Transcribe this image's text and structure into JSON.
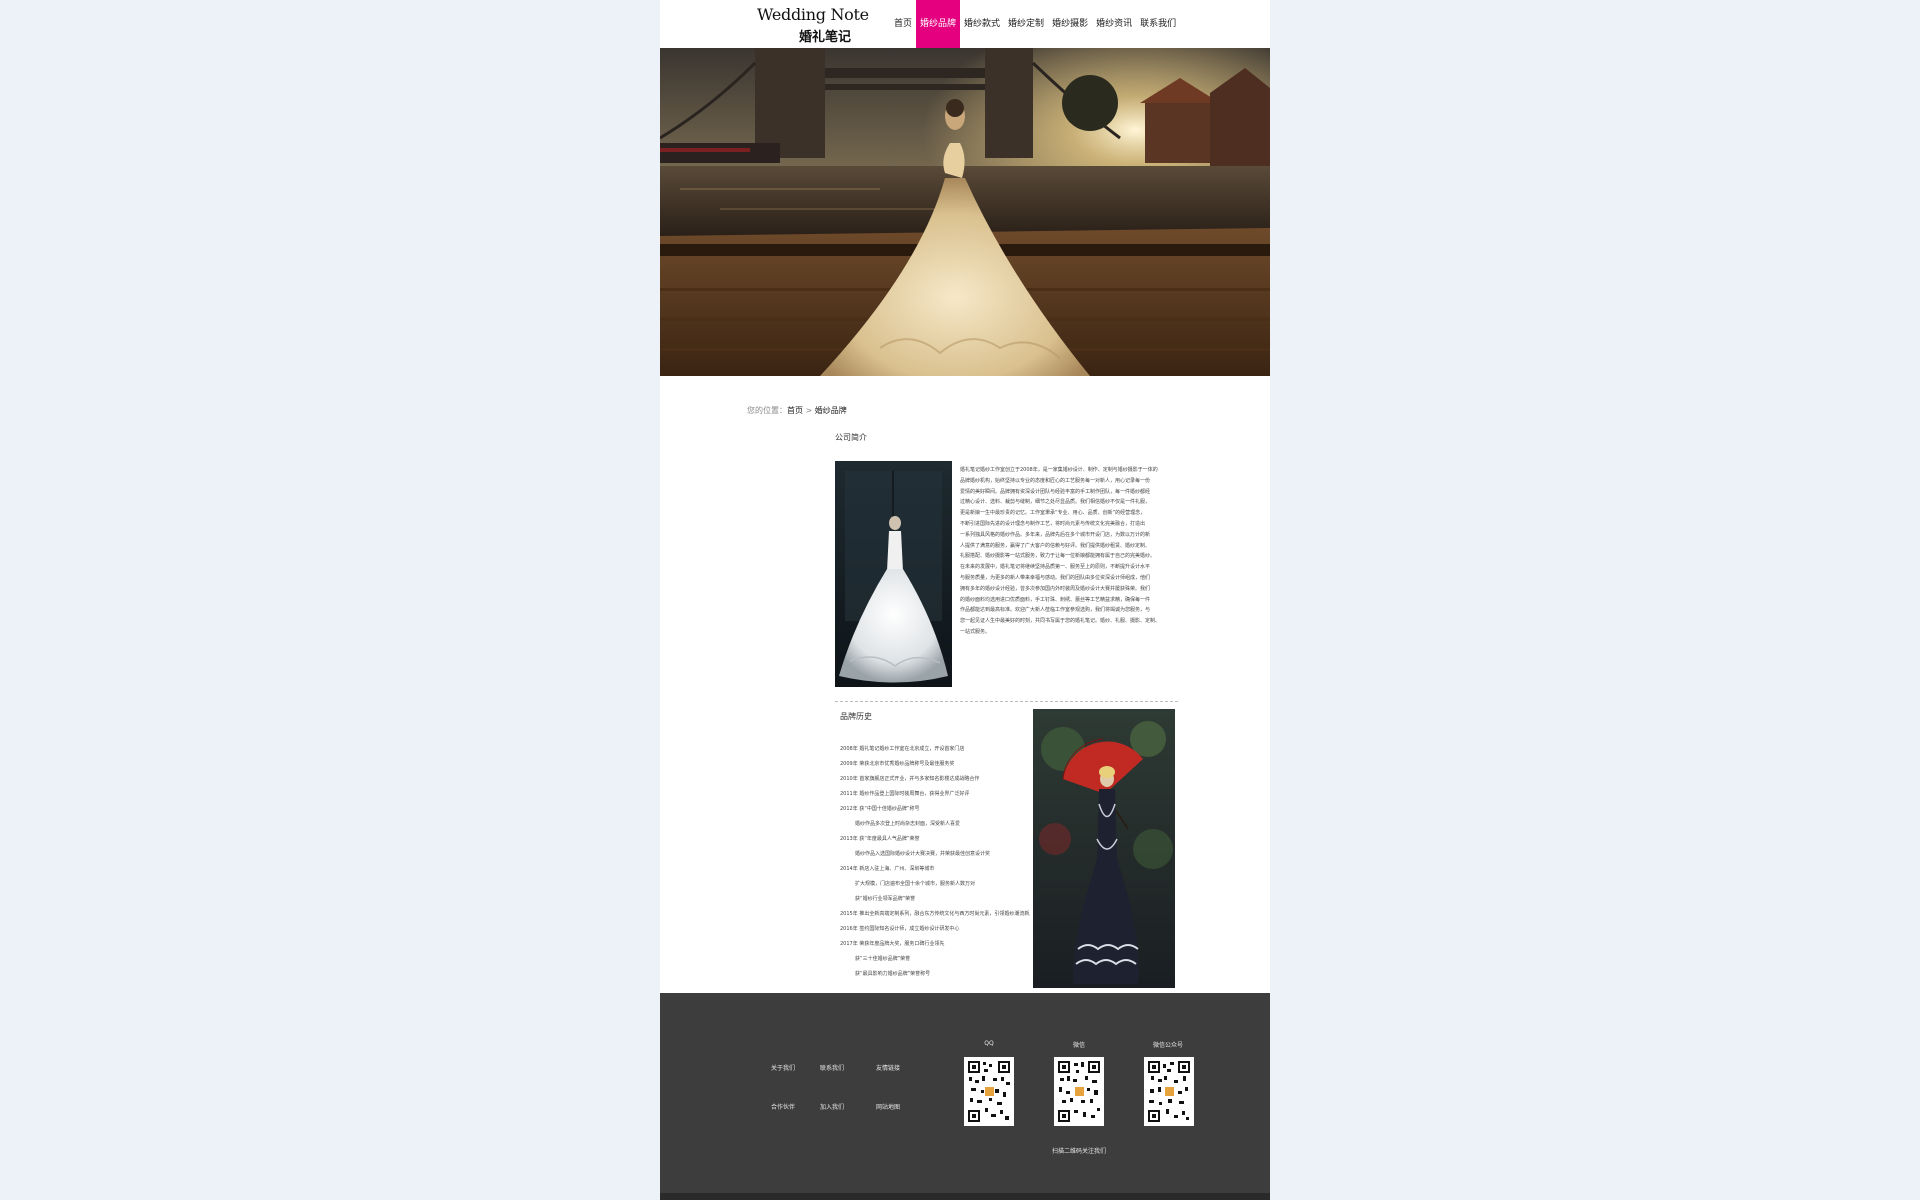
{
  "header": {
    "logo_en": "Wedding Note",
    "logo_cn": "婚礼笔记",
    "nav": [
      "首页",
      "婚纱品牌",
      "婚纱款式",
      "婚纱定制",
      "婚纱摄影",
      "婚纱资讯",
      "联系我们"
    ],
    "active_index": 1,
    "accent_color": "#e4007f"
  },
  "breadcrumb": {
    "prefix": "您的位置：",
    "home": "首页",
    "separator": " > ",
    "current": "婚纱品牌"
  },
  "intro": {
    "title": "公司简介",
    "lines": [
      "婚礼笔记婚纱工作室创立于2008年，是一家集婚纱设计、制作、定制与婚纱摄影于一体的",
      "品牌婚纱机构，始终坚持以专业的态度和匠心的工艺服务每一对新人，用心记录每一份",
      "爱情的美好瞬间。品牌拥有资深设计团队与经验丰富的手工制作团队，每一件婚纱都经",
      "过精心设计、选料、裁剪与缝制，细节之处尽显品质。我们相信婚纱不仅是一件礼服，",
      "更是新娘一生中最珍贵的记忆。工作室秉承“专业、用心、品质、创新”的经营理念，",
      "不断引进国际先进的设计理念与制作工艺，将时尚元素与传统文化完美融合，打造出",
      "一系列独具风格的婚纱作品。多年来，品牌先后在多个城市开设门店，为数以万计的新",
      "人提供了满意的服务，赢得了广大客户的信赖与好评。我们提供婚纱租赁、婚纱定制、",
      "礼服搭配、婚纱摄影等一站式服务，致力于让每一位新娘都能拥有属于自己的完美婚纱。",
      "在未来的发展中，婚礼笔记将继续坚持品质第一、服务至上的原则，不断提升设计水平",
      "与服务质量，为更多的新人带来幸福与感动。我们的团队由多位资深设计师组成，他们",
      "拥有多年的婚纱设计经验，曾多次参加国内外时装周及婚纱设计大赛并屡获殊荣。我们",
      "的婚纱面料均选用进口优质面料，手工钉珠、刺绣、蕾丝等工艺精益求精，确保每一件",
      "作品都能达到最高标准。欢迎广大新人莅临工作室参观选购，我们将竭诚为您服务，与",
      "您一起见证人生中最美好的时刻，共同书写属于您的婚礼笔记。婚纱、礼服、摄影、定制、",
      "一站式服务。"
    ]
  },
  "history": {
    "title": "品牌历史",
    "items": [
      {
        "text": "2008年 婚礼笔记婚纱工作室在北京成立，开设首家门店",
        "indent": false
      },
      {
        "text": "2009年 荣获北京市优秀婚纱品牌称号及最佳服务奖",
        "indent": false
      },
      {
        "text": "2010年 首家旗舰店正式开业，并与多家知名影楼达成战略合作",
        "indent": false
      },
      {
        "text": "2011年 婚纱作品登上国际时装周舞台，获得业界广泛好评",
        "indent": false
      },
      {
        "text": "2012年 获“中国十佳婚纱品牌”称号",
        "indent": false
      },
      {
        "text": "婚纱作品多次登上时尚杂志封面，深受新人喜爱",
        "indent": true
      },
      {
        "text": "2013年 获“年度最具人气品牌”荣誉",
        "indent": false
      },
      {
        "text": "婚纱作品入选国际婚纱设计大赛决赛，并荣获最佳创意设计奖",
        "indent": true
      },
      {
        "text": "2014年 新店入驻上海、广州、深圳等城市",
        "indent": false
      },
      {
        "text": "扩大规模，门店遍布全国十余个城市，服务新人数万对",
        "indent": true
      },
      {
        "text": "获“婚纱行业领军品牌”荣誉",
        "indent": true
      },
      {
        "text": "2015年 推出全新高端定制系列，融合东方传统文化与西方时尚元素，引领婚纱潮流新风尚",
        "indent": false
      },
      {
        "text": "2016年 签约国际知名设计师，成立婚纱设计研发中心",
        "indent": false
      },
      {
        "text": "2017年 荣获年度品牌大奖，服务口碑行业领先",
        "indent": false
      },
      {
        "text": "获“三十佳婚纱品牌”荣誉",
        "indent": true
      },
      {
        "text": "获“最具影响力婚纱品牌”荣誉称号",
        "indent": true
      }
    ]
  },
  "footer": {
    "links": [
      "关于我们",
      "联系我们",
      "友情链接",
      "合作伙伴",
      "加入我们",
      "网站地图"
    ],
    "qr_labels": [
      "QQ",
      "微信",
      "微信公众号"
    ],
    "note": "扫描二维码关注我们"
  }
}
